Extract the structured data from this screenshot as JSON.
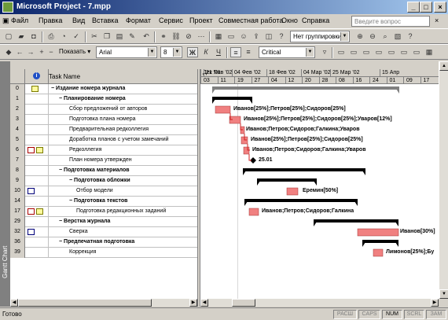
{
  "window": {
    "title": "Microsoft Project - 7.mpp"
  },
  "menu": {
    "items": [
      "Файл",
      "Правка",
      "Вид",
      "Вставка",
      "Формат",
      "Сервис",
      "Проект",
      "Совместная работа",
      "Окно",
      "Справка"
    ],
    "help_placeholder": "Введите вопрос"
  },
  "toolbar1": {
    "grouping": "Нет группировки"
  },
  "toolbar2": {
    "show_label": "Показать",
    "font": "Arial",
    "size": "8",
    "filter": "Critical"
  },
  "view_bar": {
    "label": "Gantt Chart"
  },
  "table": {
    "header_name": "Task Name",
    "rows": [
      {
        "id": "0",
        "name": "Издание номера журнала",
        "level": 0,
        "bold": true,
        "note": true
      },
      {
        "id": "1",
        "name": "Планирование номера",
        "level": 1,
        "bold": true
      },
      {
        "id": "2",
        "name": "Сбор предложений от авторов",
        "level": 2
      },
      {
        "id": "3",
        "name": "Подготовка плана номера",
        "level": 2
      },
      {
        "id": "4",
        "name": "Предварительная редколлегия",
        "level": 2
      },
      {
        "id": "5",
        "name": "Доработка планов с учетом замечаний",
        "level": 2
      },
      {
        "id": "6",
        "name": "Редколлегия",
        "level": 2,
        "cal": true,
        "note": true
      },
      {
        "id": "7",
        "name": "План номера утвержден",
        "level": 2
      },
      {
        "id": "8",
        "name": "Подготовка материалов",
        "level": 1,
        "bold": true
      },
      {
        "id": "9",
        "name": "Подготовка обложки",
        "level": 2,
        "bold": true
      },
      {
        "id": "10",
        "name": "Отбор модели",
        "level": 3,
        "grid": true
      },
      {
        "id": "14",
        "name": "Подготовка текстов",
        "level": 2,
        "bold": true
      },
      {
        "id": "17",
        "name": "Подготовка редакционных заданий",
        "level": 3,
        "cal": true,
        "note": true
      },
      {
        "id": "29",
        "name": "Верстка журнала",
        "level": 1,
        "bold": true
      },
      {
        "id": "32",
        "name": "Сверка",
        "level": 2,
        "grid": true
      },
      {
        "id": "36",
        "name": "Предпечатная подготовка",
        "level": 1,
        "bold": true
      },
      {
        "id": "39",
        "name": "Коррекция",
        "level": 2
      }
    ]
  },
  "timescale": {
    "weeks": [
      "Дек '01",
      "21 Янв '02",
      "04 Фев '02",
      "18 Фев '02",
      "04 Мар '02",
      "25 Мар '02",
      "15 Апр"
    ],
    "days": [
      "03",
      "11",
      "19",
      "27",
      "04",
      "12",
      "20",
      "28",
      "08",
      "16",
      "24",
      "01",
      "09",
      "17"
    ]
  },
  "gantt_labels": {
    "r2": "Иванов[25%];Петров[25%];Сидоров[25%]",
    "r3": "Иванов[25%];Петров[25%];Сидоров[25%];Уваров[12%]",
    "r4": "Иванов;Петров;Сидоров;Галкина;Уваров",
    "r5": "Иванов[25%];Петров[25%];Сидоров[25%]",
    "r6": "Иванов;Петров;Сидоров;Галкина;Уваров",
    "r7": "25.01",
    "r10": "Еремин[50%]",
    "r17": "Иванов;Петров;Сидоров;Галкина",
    "r32": "Иванов[30%]",
    "r39": "Лимонов[25%];Бу"
  },
  "status": {
    "ready": "Готово",
    "indicators": [
      "РАСШ",
      "CAPS",
      "NUM",
      "SCRL",
      "ЗАМ"
    ]
  }
}
